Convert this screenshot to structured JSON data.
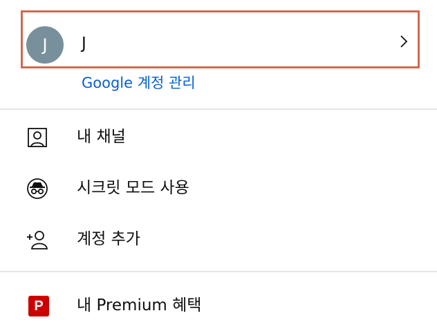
{
  "account": {
    "avatar_initial": "J",
    "name": "J",
    "manage_link": "Google 계정 관리"
  },
  "menu": {
    "items": [
      {
        "label": "내 채널",
        "icon": "person-box-icon"
      },
      {
        "label": "시크릿 모드 사용",
        "icon": "incognito-icon"
      },
      {
        "label": "계정 추가",
        "icon": "add-person-icon"
      }
    ],
    "premium": {
      "label": "내 Premium 혜택",
      "badge": "P",
      "icon": "premium-badge-icon"
    }
  },
  "colors": {
    "highlight_border": "#d0694e",
    "avatar_bg": "#78909c",
    "link": "#065fd4",
    "premium_red": "#cc0000"
  }
}
